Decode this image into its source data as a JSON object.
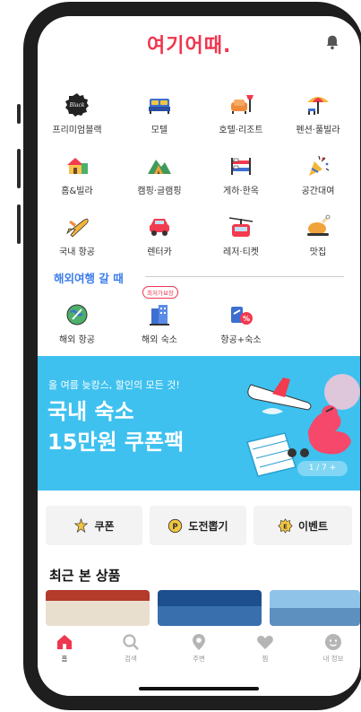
{
  "app": {
    "logo_text": "여기어때."
  },
  "categories": [
    {
      "label": "프리미엄블랙",
      "icon": "premium-black-icon"
    },
    {
      "label": "모텔",
      "icon": "motel-bed-icon"
    },
    {
      "label": "호텔·리조트",
      "icon": "hotel-sofa-icon"
    },
    {
      "label": "펜션·풀빌라",
      "icon": "pension-umbrella-icon"
    },
    {
      "label": "홈&빌라",
      "icon": "home-villa-icon"
    },
    {
      "label": "캠핑·글램핑",
      "icon": "camping-tent-icon"
    },
    {
      "label": "게하·한옥",
      "icon": "guesthouse-bunkbed-icon"
    },
    {
      "label": "공간대여",
      "icon": "party-popper-icon"
    },
    {
      "label": "국내 항공",
      "icon": "airplane-icon"
    },
    {
      "label": "렌터카",
      "icon": "car-icon"
    },
    {
      "label": "레저·티켓",
      "icon": "cable-car-icon"
    },
    {
      "label": "맛집",
      "icon": "food-dish-icon"
    }
  ],
  "overseas": {
    "title": "해외여행 갈 때",
    "items": [
      {
        "label": "해외 항공",
        "icon": "globe-plane-icon"
      },
      {
        "label": "해외 숙소",
        "icon": "overseas-building-icon",
        "badge": "최저가보장"
      },
      {
        "label": "항공+숙소",
        "icon": "flight-hotel-discount-icon"
      }
    ]
  },
  "banner": {
    "subtitle": "올 여름 늦캉스, 할인의 모든 것!",
    "title_line1": "국내 숙소",
    "title_line2": "15만원 쿠폰팩",
    "pager": "1 / 7 +"
  },
  "quick_buttons": [
    {
      "label": "쿠폰",
      "icon": "coupon-star-icon"
    },
    {
      "label": "도전뽑기",
      "icon": "p-circle-icon"
    },
    {
      "label": "이벤트",
      "icon": "event-gift-icon"
    }
  ],
  "recent": {
    "title": "최근 본 상품"
  },
  "bottom_nav": [
    {
      "label": "홈",
      "icon": "home-icon",
      "active": true
    },
    {
      "label": "검색",
      "icon": "search-icon"
    },
    {
      "label": "주변",
      "icon": "location-pin-icon"
    },
    {
      "label": "찜",
      "icon": "heart-icon"
    },
    {
      "label": "내 정보",
      "icon": "profile-face-icon"
    }
  ],
  "colors": {
    "brand": "#f0364f",
    "section_blue": "#3b7ded",
    "banner_bg": "#3ec1ef",
    "quick_bg": "#f3f3f3"
  }
}
